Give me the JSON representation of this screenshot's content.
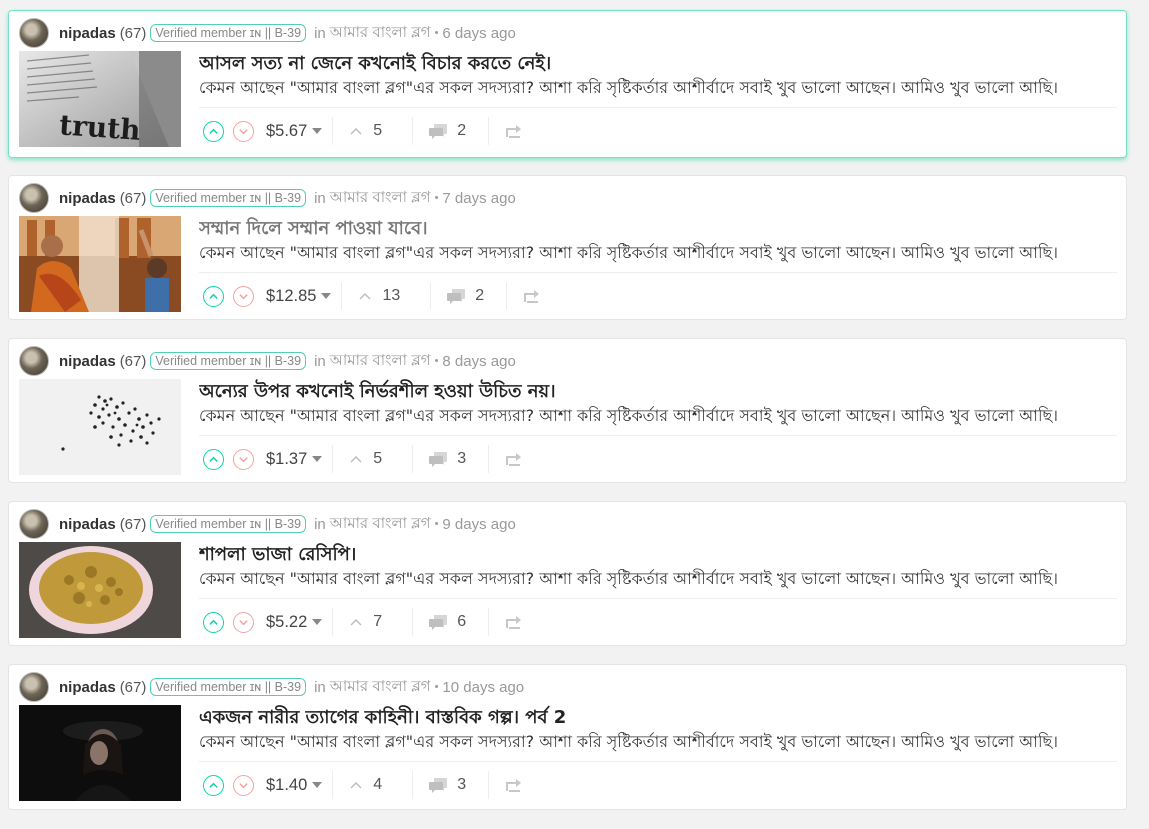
{
  "colors": {
    "accent": "#06d6a9",
    "downvote": "#f4a0a0",
    "active_border": "#74e2c4",
    "badge_border": "#4fd1b0"
  },
  "posts": [
    {
      "author": "nipadas",
      "reputation": "(67)",
      "badge": "Verified member ɪɴ || B-39",
      "in_label": "in",
      "community": "আমার বাংলা ব্লগ",
      "time": "6 days ago",
      "title": "আসল সত্য না জেনে কখনোই বিচার করতে নেই।",
      "excerpt": "কেমন আছেন \"আমার বাংলা ব্লগ\"এর সকল সদস্যরা? আশা করি সৃষ্টিকর্তার আশীর্বাদে সবাই খুব ভালো আছেন। আমিও খুব ভালো আছি।",
      "payout": "$5.67",
      "votes": "5",
      "comments": "2",
      "thumbnail_icon": "newspaper-truth-image",
      "title_muted": false
    },
    {
      "author": "nipadas",
      "reputation": "(67)",
      "badge": "Verified member ɪɴ || B-39",
      "in_label": "in",
      "community": "আমার বাংলা ব্লগ",
      "time": "7 days ago",
      "title": "সম্মান দিলে সম্মান পাওয়া যাবে।",
      "excerpt": "কেমন আছেন \"আমার বাংলা ব্লগ\"এর সকল সদস্যরা? আশা করি সৃষ্টিকর্তার আশীর্বাদে সবাই খুব ভালো আছেন। আমিও খুব ভালো আছি।",
      "payout": "$12.85",
      "votes": "13",
      "comments": "2",
      "thumbnail_icon": "monk-and-child-image",
      "title_muted": true
    },
    {
      "author": "nipadas",
      "reputation": "(67)",
      "badge": "Verified member ɪɴ || B-39",
      "in_label": "in",
      "community": "আমার বাংলা ব্লগ",
      "time": "8 days ago",
      "title": "অন্যের উপর কখনোই নির্ভরশীল হওয়া উচিত নয়।",
      "excerpt": "কেমন আছেন \"আমার বাংলা ব্লগ\"এর সকল সদস্যরা? আশা করি সৃষ্টিকর্তার আশীর্বাদে সবাই খুব ভালো আছেন। আমিও খুব ভালো আছি।",
      "payout": "$1.37",
      "votes": "5",
      "comments": "3",
      "thumbnail_icon": "ants-cluster-image",
      "title_muted": false
    },
    {
      "author": "nipadas",
      "reputation": "(67)",
      "badge": "Verified member ɪɴ || B-39",
      "in_label": "in",
      "community": "আমার বাংলা ব্লগ",
      "time": "9 days ago",
      "title": "শাপলা ভাজা রেসিপি।",
      "excerpt": "কেমন আছেন \"আমার বাংলা ব্লগ\"এর সকল সদস্যরা? আশা করি সৃষ্টিকর্তার আশীর্বাদে সবাই খুব ভালো আছেন। আমিও খুব ভালো আছি।",
      "payout": "$5.22",
      "votes": "7",
      "comments": "6",
      "thumbnail_icon": "fried-food-plate-image",
      "title_muted": false
    },
    {
      "author": "nipadas",
      "reputation": "(67)",
      "badge": "Verified member ɪɴ || B-39",
      "in_label": "in",
      "community": "আমার বাংলা ব্লগ",
      "time": "10 days ago",
      "title": "একজন নারীর ত্যাগের কাহিনী। বাস্তবিক গল্প। পর্ব 2",
      "excerpt": "কেমন আছেন \"আমার বাংলা ব্লগ\"এর সকল সদস্যরা? আশা করি সৃষ্টিকর্তার আশীর্বাদে সবাই খুব ভালো আছেন। আমিও খুব ভালো আছি।",
      "payout": "$1.40",
      "votes": "4",
      "comments": "3",
      "thumbnail_icon": "woman-in-dark-image",
      "title_muted": false
    }
  ]
}
